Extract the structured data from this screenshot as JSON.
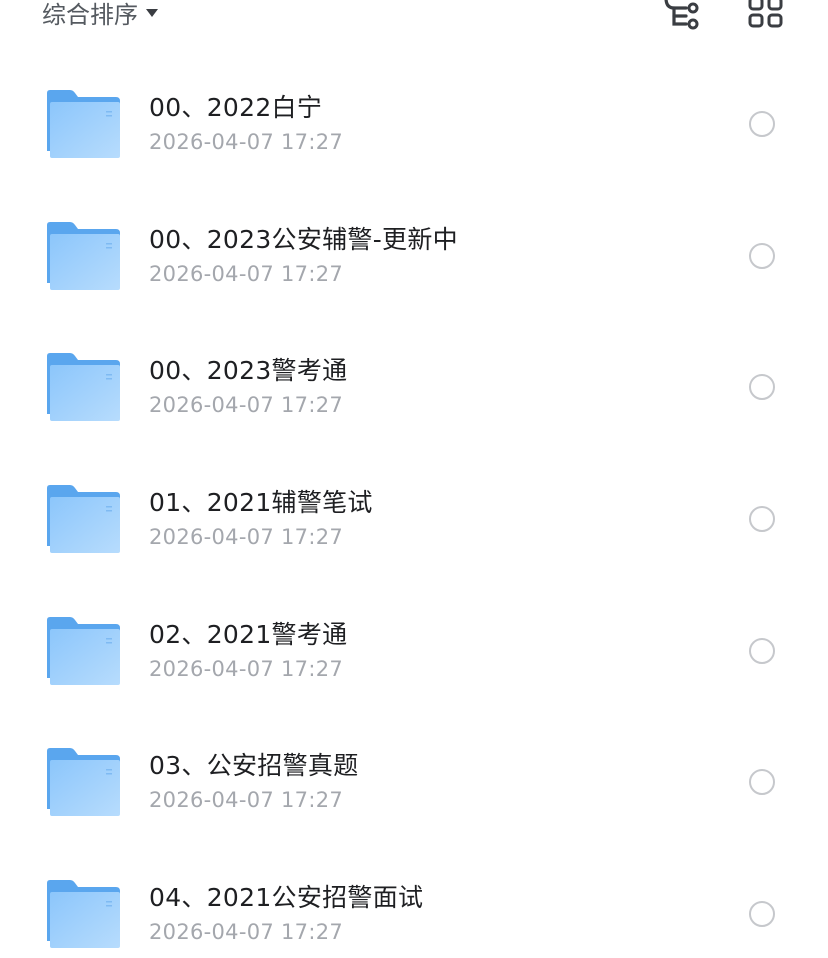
{
  "toolbar": {
    "sort_label": "综合排序",
    "sort_icon": "caret-down-icon",
    "tree_view_icon": "tree-view-icon",
    "grid_view_icon": "grid-view-icon"
  },
  "files": [
    {
      "name": "00、2022白宁",
      "date": "2026-04-07 17:27",
      "icon": "folder-icon"
    },
    {
      "name": "00、2023公安辅警-更新中",
      "date": "2026-04-07 17:27",
      "icon": "folder-icon"
    },
    {
      "name": "00、2023警考通",
      "date": "2026-04-07 17:27",
      "icon": "folder-icon"
    },
    {
      "name": "01、2021辅警笔试",
      "date": "2026-04-07 17:27",
      "icon": "folder-icon"
    },
    {
      "name": "02、2021警考通",
      "date": "2026-04-07 17:27",
      "icon": "folder-icon"
    },
    {
      "name": "03、公安招警真题",
      "date": "2026-04-07 17:27",
      "icon": "folder-icon"
    },
    {
      "name": "04、2021公安招警面试",
      "date": "2026-04-07 17:27",
      "icon": "folder-icon"
    }
  ],
  "colors": {
    "folder_back": "#5aa6ee",
    "folder_front_top": "#8cc6fb",
    "folder_front_bottom": "#b7dcfd",
    "text_primary": "#1e1f22",
    "text_secondary": "#a4a7ad",
    "radio_border": "#c6c8cc"
  }
}
